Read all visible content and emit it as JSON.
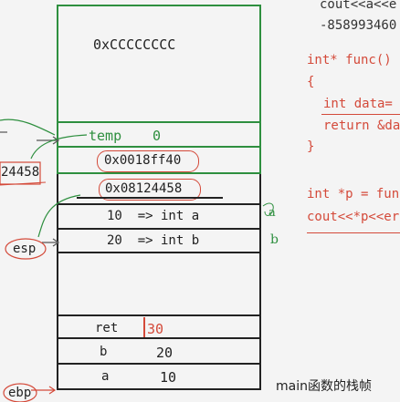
{
  "stack": {
    "top_value": "0xCCCCCCCC",
    "temp_label": "temp",
    "temp_value": "0",
    "addr1": "0x0018ff40",
    "addr2": "0x08124458",
    "row_a": "10  => int a",
    "row_b": "20  => int b",
    "ret_label": "ret",
    "ret_value": "30",
    "b_label": "b",
    "b_value": "20",
    "a_label": "a",
    "a_value": "10"
  },
  "left_labels": {
    "addr_fragment": "24458",
    "esp": "esp",
    "ebp": "ebp"
  },
  "side_marks": {
    "a_mark": "a",
    "b_mark": "b"
  },
  "code": {
    "line1": "cout<<a<<e",
    "line2": "-858993460",
    "line3": "int* func()",
    "line4": "{",
    "line5": "int data=",
    "line6": "return &da",
    "line7": "}",
    "line8": "int *p = fun",
    "line9": "cout<<*p<<er"
  },
  "caption": "main函数的栈帧"
}
